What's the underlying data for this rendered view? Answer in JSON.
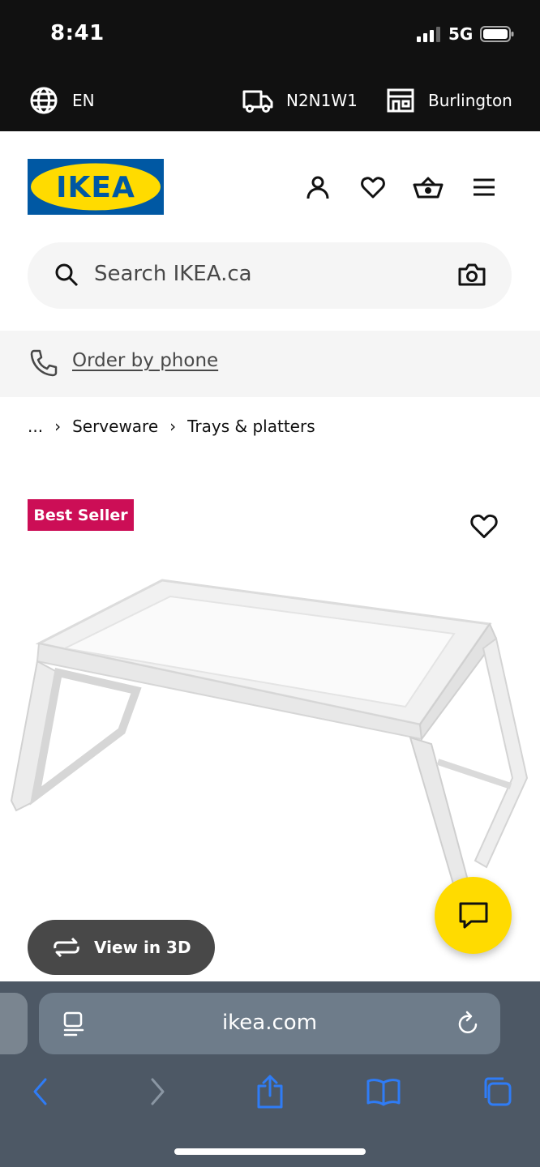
{
  "status_bar": {
    "time": "8:41",
    "network": "5G"
  },
  "info_bar": {
    "language": "EN",
    "postal_code": "N2N1W1",
    "store": "Burlington"
  },
  "header": {
    "logo_text": "IKEA",
    "icons": [
      "account-icon",
      "heart-icon",
      "basket-icon",
      "menu-icon"
    ]
  },
  "search": {
    "placeholder": "Search IKEA.ca"
  },
  "order_by_phone": {
    "label": "Order by phone"
  },
  "breadcrumb": {
    "ellipsis": "...",
    "items": [
      "Serveware",
      "Trays & platters"
    ]
  },
  "product": {
    "badge": "Best Seller",
    "view_3d_label": "View in 3D"
  },
  "browser": {
    "url": "ikea.com"
  },
  "colors": {
    "ikea_blue": "#0058a3",
    "ikea_yellow": "#ffdb00",
    "badge_red": "#cc0e56",
    "dark_bar": "#111111",
    "ios_blue": "#2f7cf6"
  }
}
